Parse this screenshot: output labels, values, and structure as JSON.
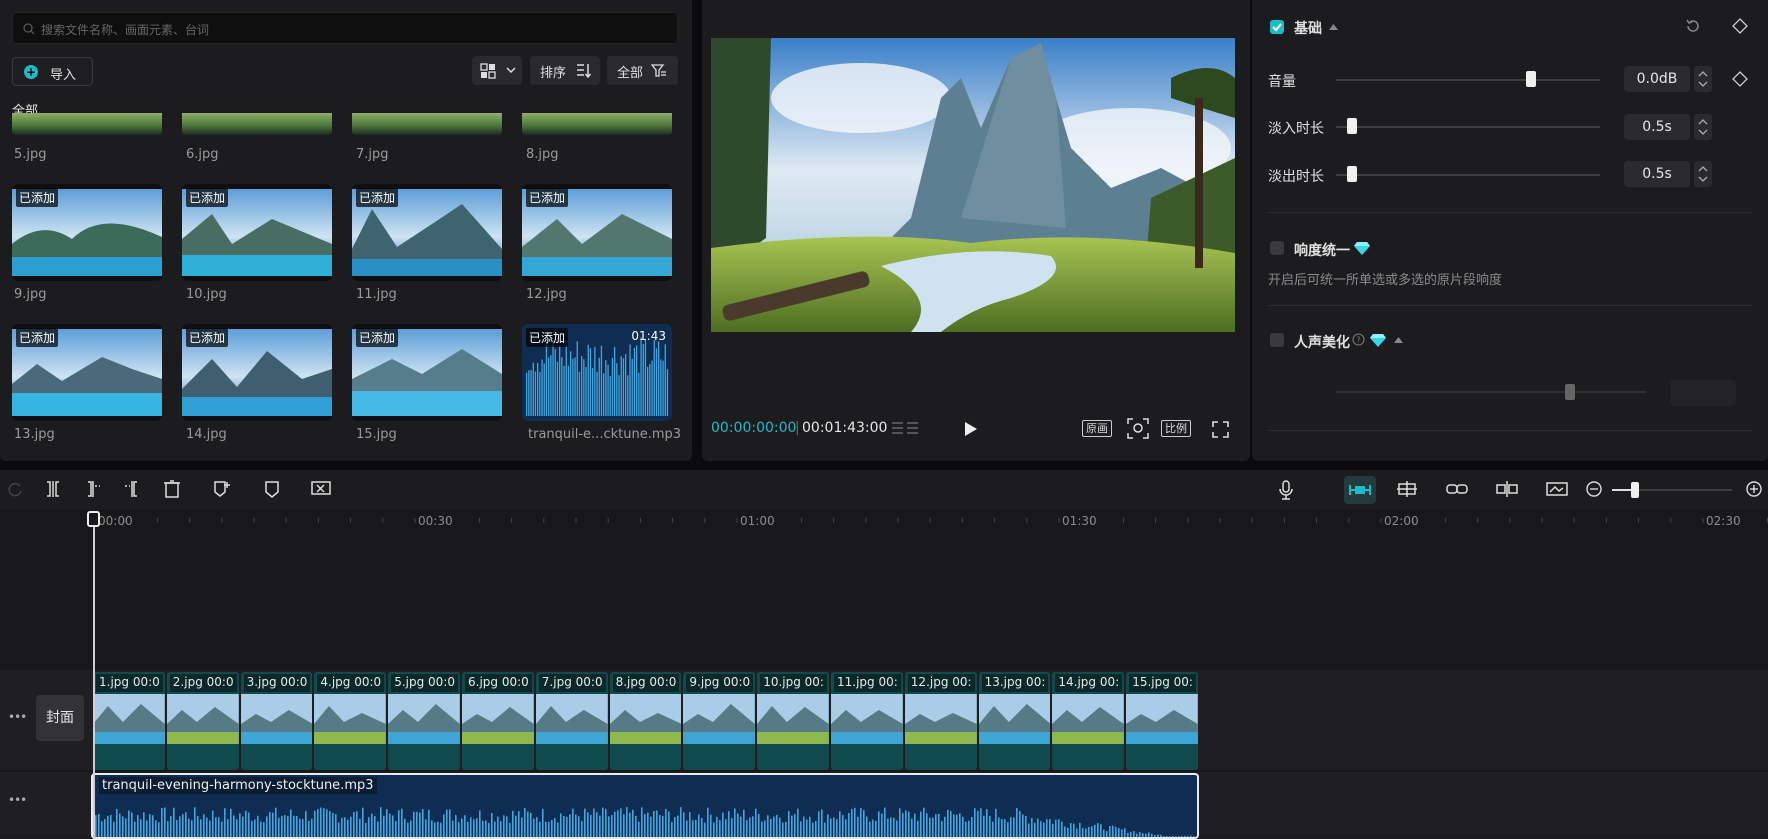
{
  "media": {
    "search_placeholder": "搜索文件名称、画面元素、台词",
    "import_label": "导入",
    "sort_label": "排序",
    "filter_label": "全部",
    "all_label": "全部",
    "top_row_names": [
      "5.jpg",
      "6.jpg",
      "7.jpg",
      "8.jpg"
    ],
    "added_badge": "已添加",
    "items": [
      {
        "name": "9.jpg"
      },
      {
        "name": "10.jpg"
      },
      {
        "name": "11.jpg"
      },
      {
        "name": "12.jpg"
      },
      {
        "name": "13.jpg"
      },
      {
        "name": "14.jpg"
      },
      {
        "name": "15.jpg"
      },
      {
        "name": "tranquil-e...cktune.mp3",
        "duration": "01:43"
      }
    ]
  },
  "player": {
    "current_time": "00:00:00:00",
    "total_time": "00:01:43:00",
    "original_label": "原画",
    "ratio_label": "比例"
  },
  "props": {
    "basic_label": "基础",
    "basic_checked": true,
    "volume_label": "音量",
    "volume_value": "0.0dB",
    "volume_level": 0.74,
    "fadein_label": "淡入时长",
    "fadein_value": "0.5s",
    "fadein_level": 0.06,
    "fadeout_label": "淡出时长",
    "fadeout_value": "0.5s",
    "fadeout_level": 0.06,
    "loudness_label": "响度统一",
    "loudness_desc": "开启后可统一所单选或多选的原片段响度",
    "vocal_label": "人声美化"
  },
  "timeline": {
    "ruler_labels": [
      "00:00",
      "00:30",
      "01:00",
      "01:30",
      "02:00",
      "02:30"
    ],
    "cover_label": "封面",
    "clips": [
      {
        "name": "1.jpg",
        "dur": "00:0"
      },
      {
        "name": "2.jpg",
        "dur": "00:0"
      },
      {
        "name": "3.jpg",
        "dur": "00:0"
      },
      {
        "name": "4.jpg",
        "dur": "00:0"
      },
      {
        "name": "5.jpg",
        "dur": "00:0"
      },
      {
        "name": "6.jpg",
        "dur": "00:0"
      },
      {
        "name": "7.jpg",
        "dur": "00:0"
      },
      {
        "name": "8.jpg",
        "dur": "00:0"
      },
      {
        "name": "9.jpg",
        "dur": "00:0"
      },
      {
        "name": "10.jpg",
        "dur": "00:"
      },
      {
        "name": "11.jpg",
        "dur": "00:"
      },
      {
        "name": "12.jpg",
        "dur": "00:"
      },
      {
        "name": "13.jpg",
        "dur": "00:"
      },
      {
        "name": "14.jpg",
        "dur": "00:"
      },
      {
        "name": "15.jpg",
        "dur": "00:"
      }
    ],
    "audio_name": "tranquil-evening-harmony-stocktune.mp3"
  },
  "colors": {
    "accent": "#19bcc8",
    "clip_bg": "#124a4c",
    "audio_bg": "#0f2d52",
    "waveform": "#3fa7e0"
  }
}
